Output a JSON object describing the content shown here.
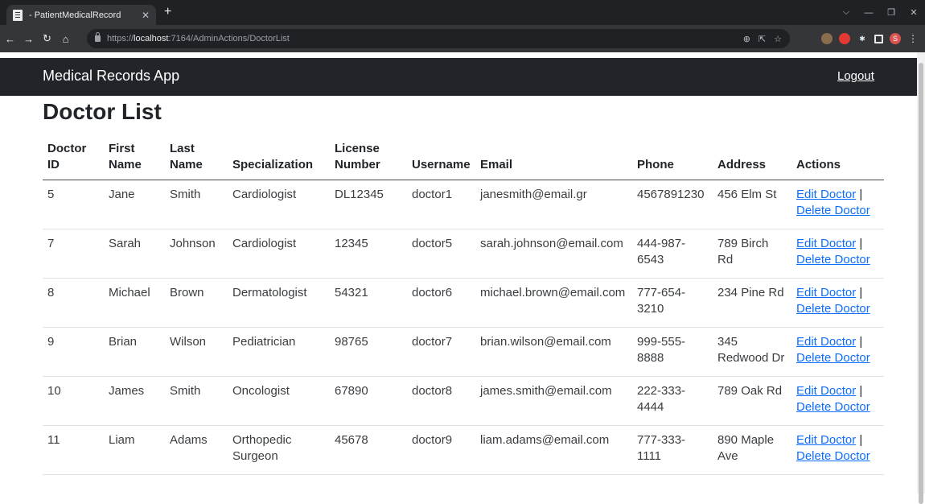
{
  "browser": {
    "tab_title": "- PatientMedicalRecord",
    "url_prefix": "https://",
    "url_host": "localhost",
    "url_path": ":7164/AdminActions/DoctorList",
    "profile_initial": "S"
  },
  "navbar": {
    "brand": "Medical Records App",
    "logout": "Logout"
  },
  "page": {
    "title": "Doctor List"
  },
  "table": {
    "headers": {
      "doctor_id_1": "Doctor",
      "doctor_id_2": "ID",
      "first_name_1": "First",
      "first_name_2": "Name",
      "last_name_1": "Last",
      "last_name_2": "Name",
      "specialization": "Specialization",
      "license_1": "License",
      "license_2": "Number",
      "username": "Username",
      "email": "Email",
      "phone": "Phone",
      "address": "Address",
      "actions": "Actions"
    },
    "edit_label": "Edit Doctor",
    "separator": " |",
    "delete_label": "Delete Doctor",
    "rows": [
      {
        "id": "5",
        "first": "Jane",
        "last": "Smith",
        "spec": "Cardiologist",
        "license": "DL12345",
        "username": "doctor1",
        "email": "janesmith@email.gr",
        "phone": "4567891230",
        "address": "456 Elm St"
      },
      {
        "id": "7",
        "first": "Sarah",
        "last": "Johnson",
        "spec": "Cardiologist",
        "license": "12345",
        "username": "doctor5",
        "email": "sarah.johnson@email.com",
        "phone": "444-987-6543",
        "address": "789 Birch Rd"
      },
      {
        "id": "8",
        "first": "Michael",
        "last": "Brown",
        "spec": "Dermatologist",
        "license": "54321",
        "username": "doctor6",
        "email": "michael.brown@email.com",
        "phone": "777-654-3210",
        "address": "234 Pine Rd"
      },
      {
        "id": "9",
        "first": "Brian",
        "last": "Wilson",
        "spec": "Pediatrician",
        "license": "98765",
        "username": "doctor7",
        "email": "brian.wilson@email.com",
        "phone": "999-555-8888",
        "address": "345 Redwood Dr"
      },
      {
        "id": "10",
        "first": "James",
        "last": "Smith",
        "spec": "Oncologist",
        "license": "67890",
        "username": "doctor8",
        "email": "james.smith@email.com",
        "phone": "222-333-4444",
        "address": "789 Oak Rd"
      },
      {
        "id": "11",
        "first": "Liam",
        "last": "Adams",
        "spec": "Orthopedic Surgeon",
        "license": "45678",
        "username": "doctor9",
        "email": "liam.adams@email.com",
        "phone": "777-333-1111",
        "address": "890 Maple Ave"
      }
    ]
  },
  "colors": {
    "navbar_bg": "#212529",
    "link": "#0d6efd",
    "chrome_dark": "#202124"
  }
}
